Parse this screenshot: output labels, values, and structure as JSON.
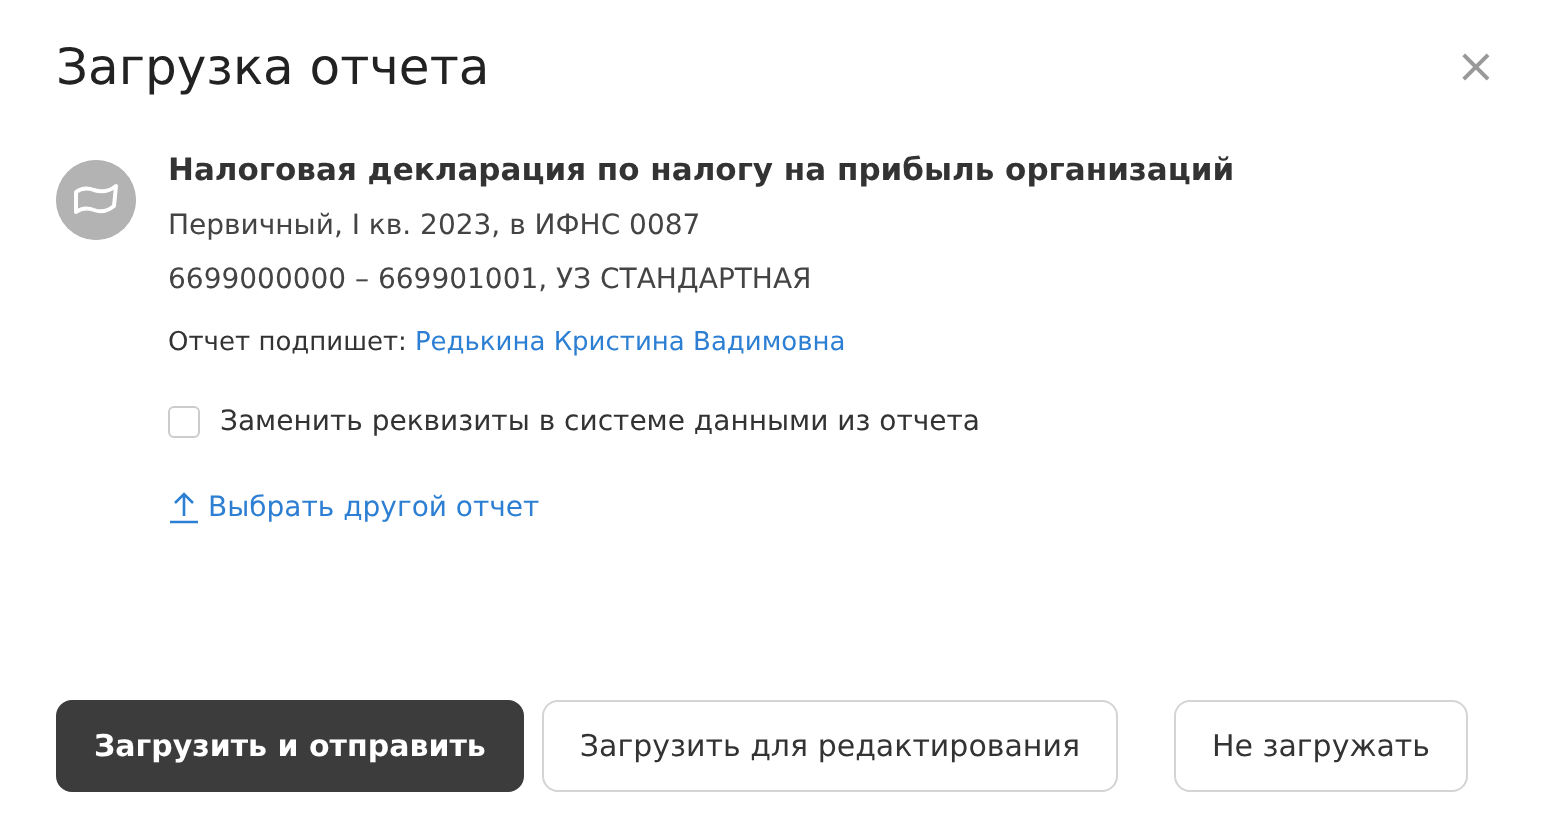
{
  "window": {
    "title": "Загрузка отчета",
    "close": "×"
  },
  "report": {
    "title": "Налоговая декларация по налогу на прибыль организаций",
    "details": [
      "Первичный, I кв. 2023, в ИФНС 0087",
      "6699000000 – 669901001, УЗ СТАНДАРТНАЯ"
    ],
    "signer_label": "Отчет подпишет:",
    "signer": "Редькина Кристина Вадимовна"
  },
  "replace_checkbox": {
    "label": "Заменить реквизиты в системе данными из отчета",
    "checked": false
  },
  "choose_link": "Выбрать другой отчет",
  "buttons": [
    {
      "label": "Загрузить и отправить",
      "kind": "primary"
    },
    {
      "label": "Загрузить для редактирования",
      "kind": "secondary"
    },
    {
      "label": "Не загружать",
      "kind": "cancel"
    }
  ]
}
